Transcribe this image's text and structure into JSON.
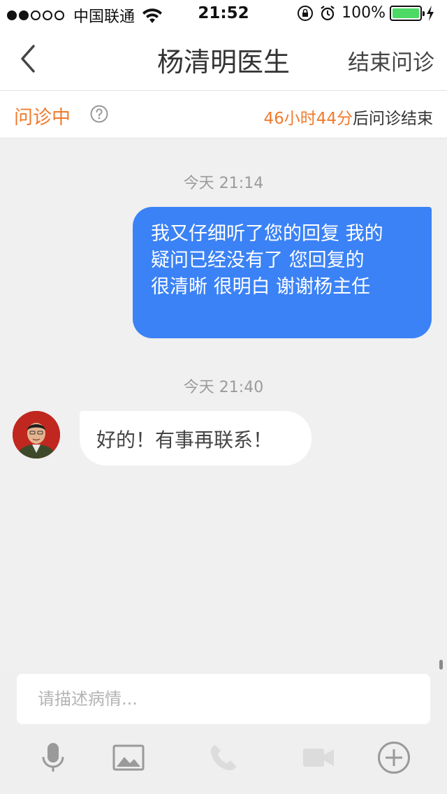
{
  "status_bar": {
    "carrier": "中国联通",
    "time": "21:52",
    "battery": "100%",
    "signal_bars_filled": 2,
    "signal_bars_total": 5
  },
  "nav": {
    "title": "杨清明医生",
    "end_button": "结束问诊"
  },
  "consult": {
    "status": "问诊中",
    "timer_highlight": "46小时44分",
    "timer_suffix": "后问诊结束"
  },
  "messages": [
    {
      "timestamp": "今天 21:14",
      "direction": "outgoing",
      "lines": [
        "我又仔细听了您的回复 我的",
        "疑问已经没有了  您回复的",
        "很清晰 很明白  谢谢杨主任"
      ]
    },
    {
      "timestamp": "今天 21:40",
      "direction": "incoming",
      "text": "好的！有事再联系！"
    }
  ],
  "input": {
    "placeholder": "请描述病情..."
  },
  "toolbar": {
    "icons": [
      "microphone-icon",
      "image-icon",
      "phone-icon",
      "video-camera-icon",
      "plus-circle-icon"
    ]
  },
  "colors": {
    "accent": "#f07b2d",
    "outgoing_bubble": "#3b82f6",
    "battery": "#4cd964"
  }
}
